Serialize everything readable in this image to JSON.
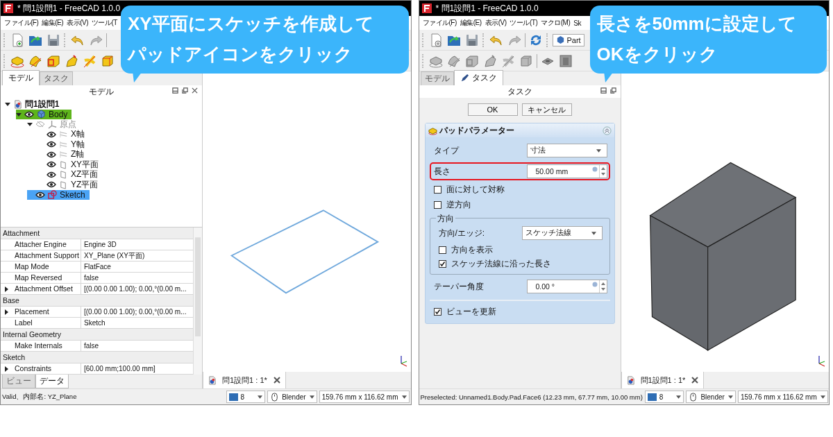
{
  "screens": [
    {
      "kind": "model",
      "title": "* 問1設問1 - FreeCAD 1.0.0",
      "menu": [
        "ファイル(F)",
        "編集(E)",
        "表示(V)",
        "ツール(T"
      ],
      "tools_enabled": true,
      "callout": [
        "XY平面にスケッチを作成して",
        "パッドアイコンをクリック"
      ],
      "dock_tabs": [
        {
          "label": "モデル",
          "selected": true
        },
        {
          "label": "タスク",
          "selected": false
        }
      ],
      "dock_title": "モデル",
      "tree": [
        {
          "label": "問1設問1",
          "kind": "document",
          "selected": false,
          "active": false,
          "expanded": true,
          "children": [
            {
              "label": "Body",
              "kind": "body",
              "visible": true,
              "selected": false,
              "active": true,
              "expanded": true,
              "children": [
                {
                  "label": "原点",
                  "kind": "origin",
                  "visible": false,
                  "selected": false,
                  "active": false,
                  "expanded": true,
                  "children": [
                    {
                      "label": "X軸",
                      "kind": "axis",
                      "visible": true,
                      "selected": false,
                      "active": false
                    },
                    {
                      "label": "Y軸",
                      "kind": "axis",
                      "visible": true,
                      "selected": false,
                      "active": false
                    },
                    {
                      "label": "Z軸",
                      "kind": "axis",
                      "visible": true,
                      "selected": false,
                      "active": false
                    },
                    {
                      "label": "XY平面",
                      "kind": "plane",
                      "visible": true,
                      "selected": false,
                      "active": false
                    },
                    {
                      "label": "XZ平面",
                      "kind": "plane",
                      "visible": true,
                      "selected": false,
                      "active": false
                    },
                    {
                      "label": "YZ平面",
                      "kind": "plane",
                      "visible": true,
                      "selected": false,
                      "active": false
                    }
                  ]
                },
                {
                  "label": "Sketch",
                  "kind": "sketch",
                  "visible": true,
                  "selected": true,
                  "active": false
                }
              ]
            }
          ]
        }
      ],
      "properties": [
        {
          "group": "Attachment",
          "rows": [
            {
              "name": "Attacher Engine",
              "value": "Engine 3D",
              "expandable": false
            },
            {
              "name": "Attachment Support",
              "value": "XY_Plane (XY平面)",
              "expandable": false
            },
            {
              "name": "Map Mode",
              "value": "FlatFace",
              "expandable": false
            },
            {
              "name": "Map Reversed",
              "value": "false",
              "expandable": false
            },
            {
              "name": "Attachment Offset",
              "value": "[(0.00 0.00 1.00); 0.00,°(0.00 m...",
              "expandable": true
            }
          ]
        },
        {
          "group": "Base",
          "rows": [
            {
              "name": "Placement",
              "value": "[(0.00 0.00 1.00); 0.00,°(0.00 m...",
              "expandable": true
            },
            {
              "name": "Label",
              "value": "Sketch",
              "expandable": false
            }
          ]
        },
        {
          "group": "Internal Geometry",
          "rows": [
            {
              "name": "Make Internals",
              "value": "false",
              "expandable": false
            }
          ]
        },
        {
          "group": "Sketch",
          "rows": [
            {
              "name": "Constraints",
              "value": "[60.00 mm;100.00 mm]",
              "expandable": true
            }
          ]
        }
      ],
      "bottom_tabs": [
        {
          "label": "ビュー",
          "selected": false
        },
        {
          "label": "データ",
          "selected": true
        }
      ],
      "view": {
        "kind": "sketch"
      },
      "doc_tab": "問1設問1 : 1*",
      "status": {
        "message": "Valid、内部名: YZ_Plane",
        "draw_style": "8",
        "navigation": "Blender",
        "dimensions": "159.76 mm x 116.62 mm"
      }
    },
    {
      "kind": "task",
      "title": "* 問1設問1 - FreeCAD 1.0.0",
      "menu": [
        "ファイル(F)",
        "編集(E)",
        "表示(V)",
        "ツール(T)",
        "マクロ(M)",
        "Sk"
      ],
      "tools_enabled": false,
      "workbench": "Part",
      "callout": [
        "長さを50mmに設定して",
        "OKをクリック"
      ],
      "dock_tabs": [
        {
          "label": "モデル",
          "selected": false
        },
        {
          "label": "タスク",
          "selected": true
        }
      ],
      "dock_title": "タスク",
      "task": {
        "buttons": [
          "OK",
          "キャンセル"
        ],
        "group_title": "パッドパラメーター",
        "rows": [
          {
            "kind": "combo",
            "label": "タイプ",
            "value": "寸法",
            "highlighted": false
          },
          {
            "kind": "spin",
            "label": "長さ",
            "value": "50.00 mm",
            "highlighted": true
          },
          {
            "kind": "checkbox",
            "label": "面に対して対称",
            "checked": false
          },
          {
            "kind": "checkbox",
            "label": "逆方向",
            "checked": false
          },
          {
            "kind": "group",
            "label": "方向",
            "rows": [
              {
                "kind": "combo",
                "label": "方向/エッジ:",
                "value": "スケッチ法線",
                "highlighted": false
              },
              {
                "kind": "checkbox",
                "label": "方向を表示",
                "checked": false
              },
              {
                "kind": "checkbox",
                "label": "スケッチ法線に沿った長さ",
                "checked": true
              }
            ]
          },
          {
            "kind": "spin",
            "label": "テーパー角度",
            "value": "0.00 °",
            "highlighted": false
          },
          {
            "kind": "separator"
          },
          {
            "kind": "checkbox",
            "label": "ビューを更新",
            "checked": true
          }
        ]
      },
      "view": {
        "kind": "solid"
      },
      "doc_tab": "問1設問1 : 1*",
      "status": {
        "message": "Preselected: Unnamed1.Body.Pad.Face6 (12.23 mm, 67.77 mm, 10.00 mm)",
        "draw_style": "8",
        "navigation": "Blender",
        "dimensions": "159.76 mm x 116.62 mm"
      }
    }
  ]
}
